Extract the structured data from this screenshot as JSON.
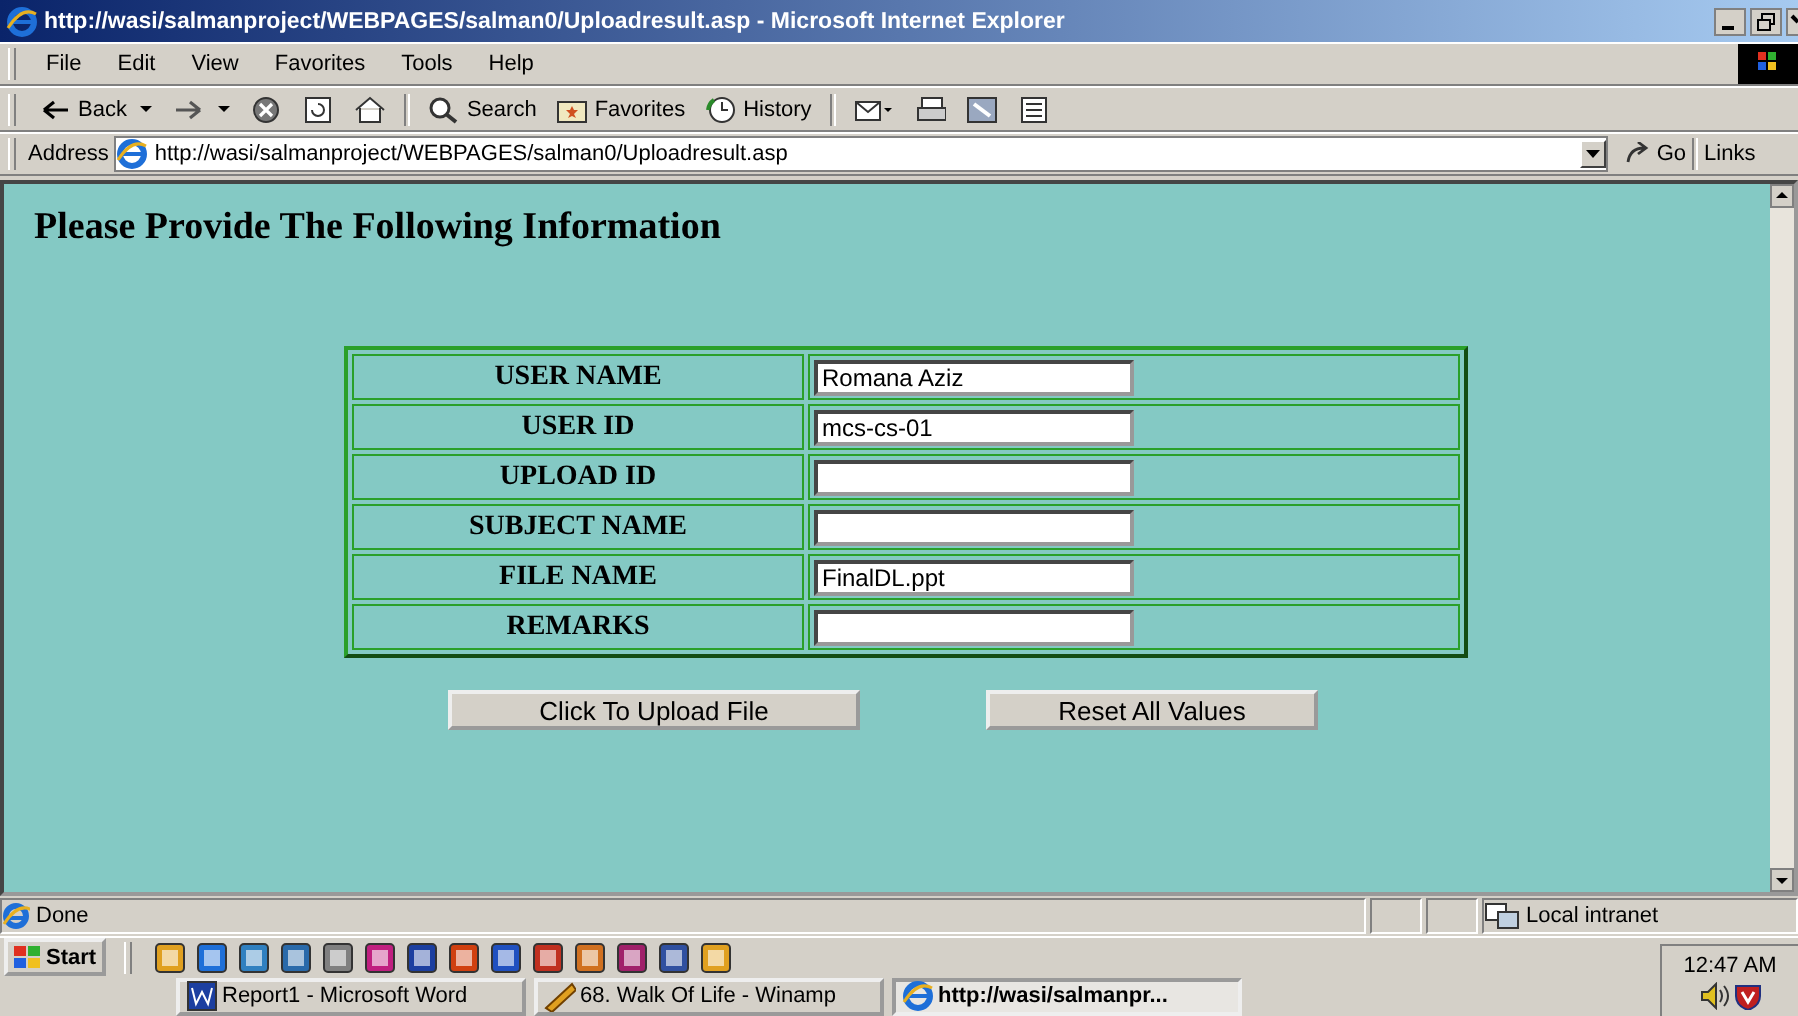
{
  "window": {
    "title": "http://wasi/salmanproject/WEBPAGES/salman0/Uploadresult.asp - Microsoft Internet Explorer"
  },
  "menu": [
    "File",
    "Edit",
    "View",
    "Favorites",
    "Tools",
    "Help"
  ],
  "toolbar": [
    {
      "kind": "back",
      "label": "Back"
    },
    {
      "kind": "forward"
    },
    {
      "kind": "stop"
    },
    {
      "kind": "refresh"
    },
    {
      "kind": "home"
    },
    {
      "kind": "search",
      "label": "Search"
    },
    {
      "kind": "favorites",
      "label": "Favorites"
    },
    {
      "kind": "history",
      "label": "History"
    },
    {
      "kind": "mail"
    },
    {
      "kind": "print"
    },
    {
      "kind": "edit"
    },
    {
      "kind": "discuss"
    }
  ],
  "address": {
    "label": "Address",
    "value": "http://wasi/salmanproject/WEBPAGES/salman0/Uploadresult.asp",
    "go": "Go",
    "links": "Links"
  },
  "page": {
    "heading": "Please Provide The Following Information",
    "fields": [
      {
        "label": "USER NAME",
        "value": "Romana Aziz"
      },
      {
        "label": "USER ID",
        "value": "mcs-cs-01"
      },
      {
        "label": "UPLOAD ID"
      },
      {
        "label": "SUBJECT NAME"
      },
      {
        "label": "FILE NAME",
        "value": "FinalDL.ppt"
      },
      {
        "label": "REMARKS"
      }
    ],
    "buttons": [
      "Click To Upload File",
      "Reset All Values"
    ]
  },
  "status_bar": {
    "text": "Done",
    "zone": "Local intranet"
  },
  "taskbar": {
    "start": "Start",
    "clock": "12:47 AM",
    "tasks": [
      {
        "label": "Report1 - Microsoft Word",
        "kind": "word",
        "selected": false
      },
      {
        "label": "68. Walk Of Life - Winamp",
        "kind": "winamp",
        "selected": false
      },
      {
        "label": "http://wasi/salmanpr...",
        "kind": "ie",
        "selected": true
      }
    ]
  }
}
